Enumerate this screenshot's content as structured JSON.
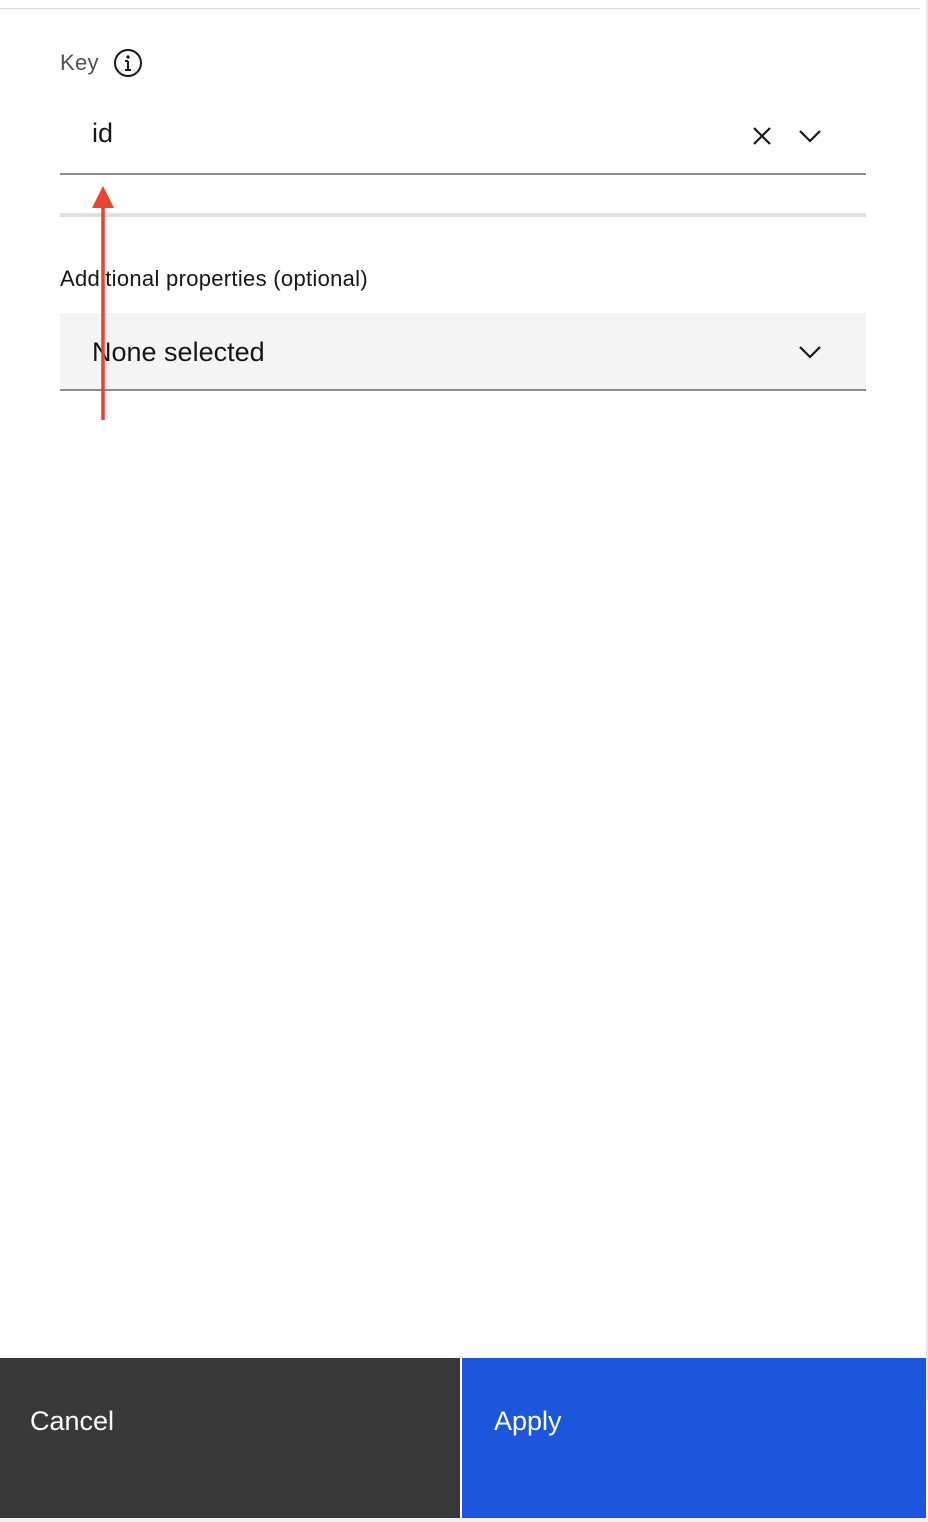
{
  "key_field": {
    "label": "Key",
    "value": "id",
    "info_icon": "information-icon",
    "clear_icon": "close-icon",
    "open_icon": "chevron-down-icon"
  },
  "additional_properties": {
    "label": "Additional properties (optional)",
    "value": "None selected",
    "open_icon": "chevron-down-icon"
  },
  "footer": {
    "cancel_label": "Cancel",
    "apply_label": "Apply"
  },
  "colors": {
    "primary": "#1b56dc",
    "secondary_button": "#393939",
    "field_background": "#f4f4f4",
    "annotation_arrow": "#e8442f"
  }
}
